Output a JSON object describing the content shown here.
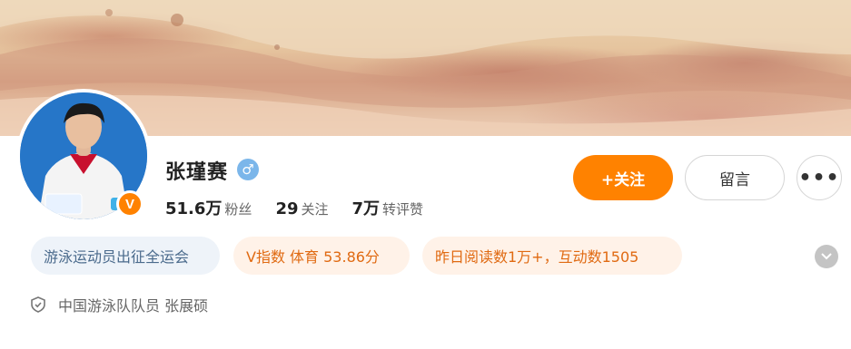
{
  "profile": {
    "name": "张瑾赛",
    "gender_icon": "male-icon",
    "verified_badge": "V",
    "stats": [
      {
        "value": "51.6万",
        "label": "粉丝"
      },
      {
        "value": "29",
        "label": "关注"
      },
      {
        "value": "7万",
        "label": "转评赞"
      }
    ]
  },
  "actions": {
    "follow_label": "+关注",
    "message_label": "留言",
    "more_label": "•••"
  },
  "tags": {
    "role": "游泳运动员出征全运会",
    "v_index": "V指数 体育 53.86分",
    "reading": "昨日阅读数1万+，互动数1505"
  },
  "verification": {
    "text": "中国游泳队队员 张展硕",
    "icon": "shield-icon"
  },
  "colors": {
    "accent": "#ff8200",
    "tag_blue_bg": "#eef3f9",
    "tag_orange_bg": "#fff2e8",
    "gender_blue": "#7bb6ea"
  }
}
